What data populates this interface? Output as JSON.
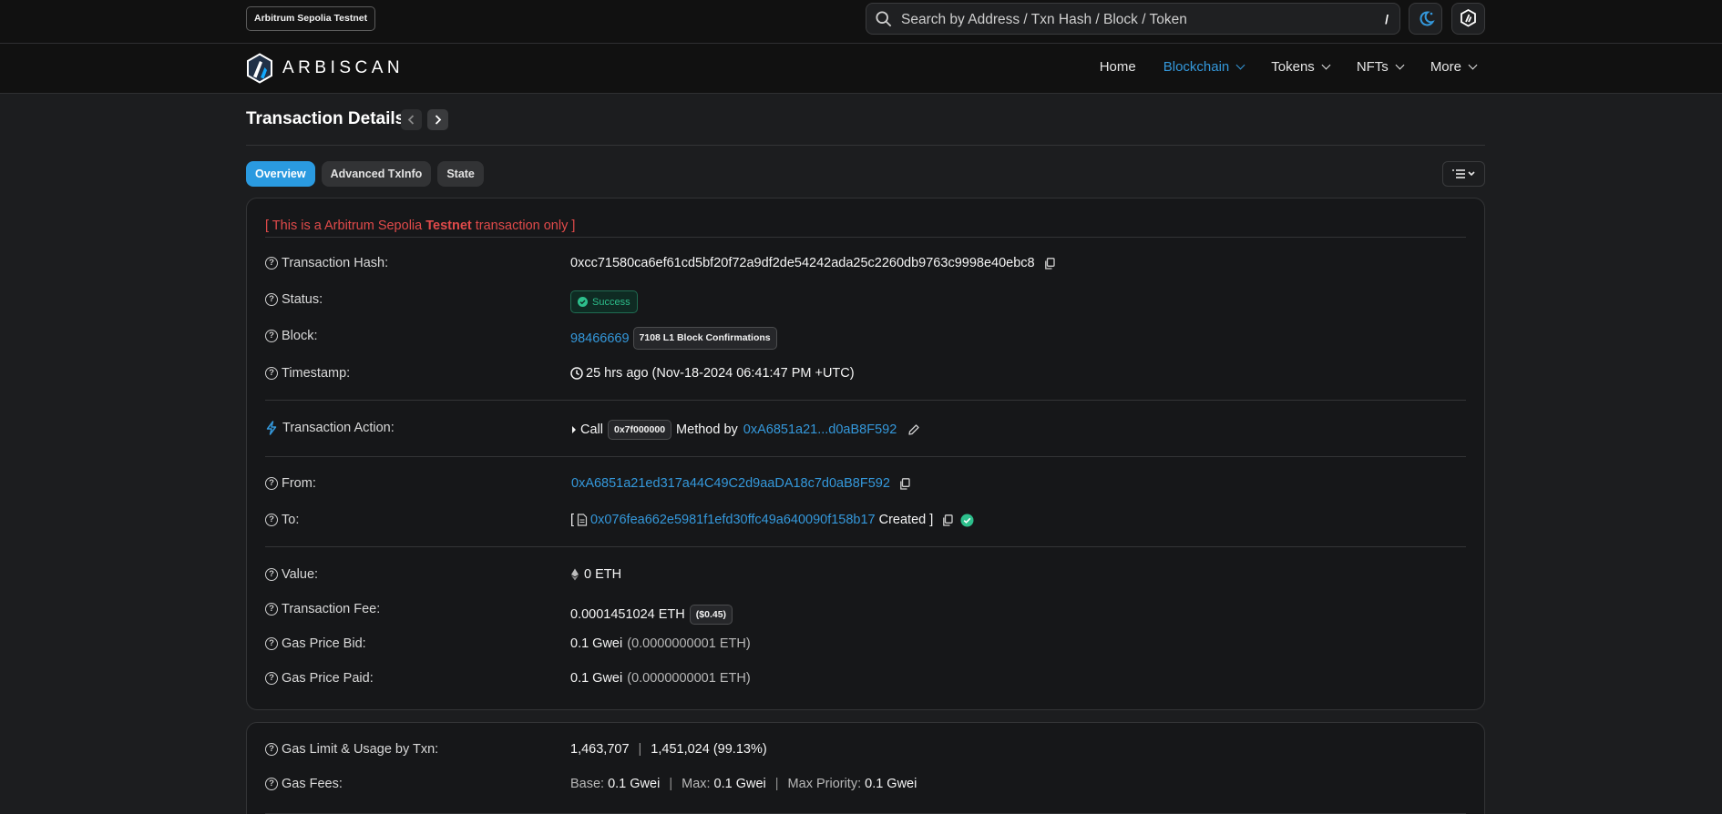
{
  "topbar": {
    "network_badge": "Arbitrum Sepolia Testnet",
    "search_placeholder": "Search by Address / Txn Hash / Block / Token",
    "search_shortcut": "/"
  },
  "nav": {
    "logo_text": "ARBISCAN",
    "items": [
      {
        "label": "Home",
        "dropdown": false,
        "active": false
      },
      {
        "label": "Blockchain",
        "dropdown": true,
        "active": true
      },
      {
        "label": "Tokens",
        "dropdown": true,
        "active": false
      },
      {
        "label": "NFTs",
        "dropdown": true,
        "active": false
      },
      {
        "label": "More",
        "dropdown": true,
        "active": false
      }
    ]
  },
  "page": {
    "title": "Transaction Details",
    "tabs": [
      "Overview",
      "Advanced TxInfo",
      "State"
    ]
  },
  "overview": {
    "testnet_notice_prefix": "[ This is a Arbitrum Sepolia ",
    "testnet_notice_bold": "Testnet",
    "testnet_notice_suffix": " transaction only ]",
    "tx_hash_label": "Transaction Hash:",
    "tx_hash": "0xcc71580ca6ef61cd5bf20f72a9df2de54242ada25c2260db9763c9998e40ebc8",
    "status_label": "Status:",
    "status": "Success",
    "block_label": "Block:",
    "block": "98466669",
    "block_confirmations": "7108 L1 Block Confirmations",
    "timestamp_label": "Timestamp:",
    "timestamp": "25 hrs ago (Nov-18-2024 06:41:47 PM +UTC)",
    "action_label": "Transaction Action:",
    "action_call": "Call",
    "action_method": "0x7f000000",
    "action_method_by": "Method by",
    "action_address": "0xA6851a21...d0aB8F592",
    "from_label": "From:",
    "from": "0xA6851a21ed317a44C49C2d9aaDA18c7d0aB8F592",
    "to_label": "To:",
    "to_open": "[",
    "to": "0x076fea662e5981f1efd30ffc49a640090f158b17",
    "to_created": "Created ]",
    "value_label": "Value:",
    "value": "0 ETH",
    "fee_label": "Transaction Fee:",
    "fee": "0.0001451024 ETH",
    "fee_usd": "($0.45)",
    "gas_bid_label": "Gas Price Bid:",
    "gas_bid": "0.1 Gwei",
    "gas_bid_eth": "(0.0000000001 ETH)",
    "gas_paid_label": "Gas Price Paid:",
    "gas_paid": "0.1 Gwei",
    "gas_paid_eth": "(0.0000000001 ETH)"
  },
  "gas": {
    "limit_label": "Gas Limit & Usage by Txn:",
    "limit": "1,463,707",
    "usage": "1,451,024 (99.13%)",
    "fees_label": "Gas Fees:",
    "base_label": "Base:",
    "base": "0.1 Gwei",
    "max_label": "Max:",
    "max": "0.1 Gwei",
    "max_priority_label": "Max Priority:",
    "max_priority": "0.1 Gwei"
  },
  "colors": {
    "accent": "#3498db",
    "success": "#2dbf8c",
    "testnet_red": "#e04a4a"
  }
}
